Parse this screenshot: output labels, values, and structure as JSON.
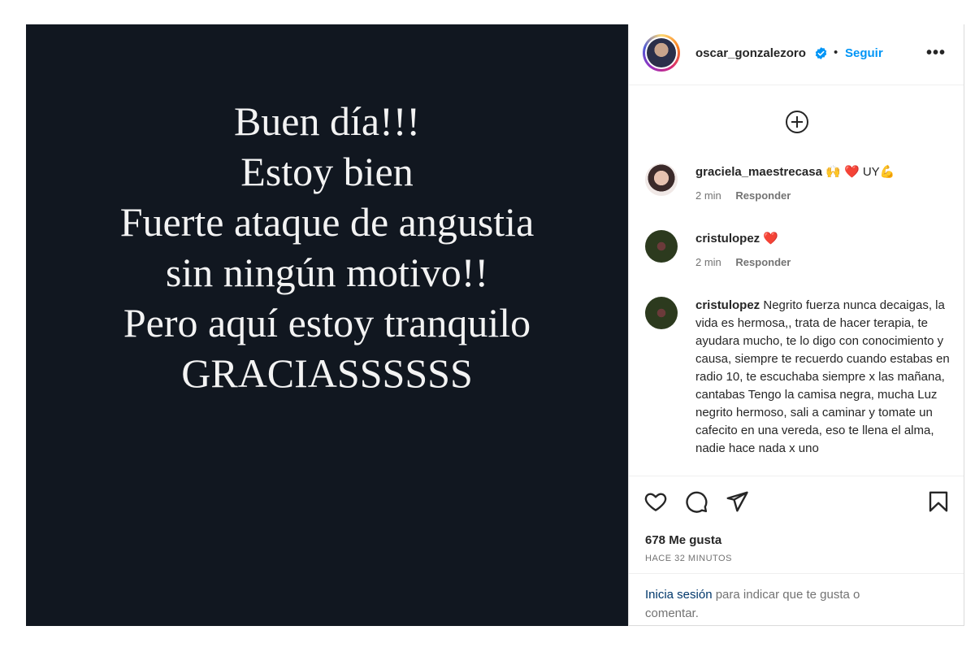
{
  "post": {
    "lines": [
      "Buen día!!!",
      "Estoy bien",
      "Fuerte ataque de angustia",
      "sin ningún motivo!!",
      "Pero aquí estoy tranquilo",
      "GRACIASSSSSS"
    ]
  },
  "header": {
    "username": "oscar_gonzalezoro",
    "separator": "•",
    "follow_label": "Seguir",
    "more_label": "•••"
  },
  "comments": [
    {
      "user": "graciela_maestrecasa",
      "text": "🙌 ❤️ UY💪",
      "time": "2 min",
      "reply": "Responder"
    },
    {
      "user": "cristulopez",
      "text": "❤️",
      "time": "2 min",
      "reply": "Responder"
    },
    {
      "user": "cristulopez",
      "text": "Negrito fuerza nunca decaigas, la vida es hermosa,, trata de hacer terapia, te ayudara mucho, te lo digo con conocimiento y causa, siempre te recuerdo cuando estabas en radio 10, te escuchaba siempre x las mañana, cantabas Tengo la camisa negra, mucha Luz negrito hermoso, sali a caminar y tomate un cafecito en una vereda, eso te llena el alma, nadie hace nada x uno"
    }
  ],
  "stats": {
    "likes": "678 Me gusta",
    "time": "HACE 32 MINUTOS"
  },
  "login": {
    "link": "Inicia sesión",
    "text": " para indicar que te gusta o comentar."
  },
  "colors": {
    "media_bg": "#111720",
    "accent": "#0095f6",
    "verified": "#0095f6"
  }
}
